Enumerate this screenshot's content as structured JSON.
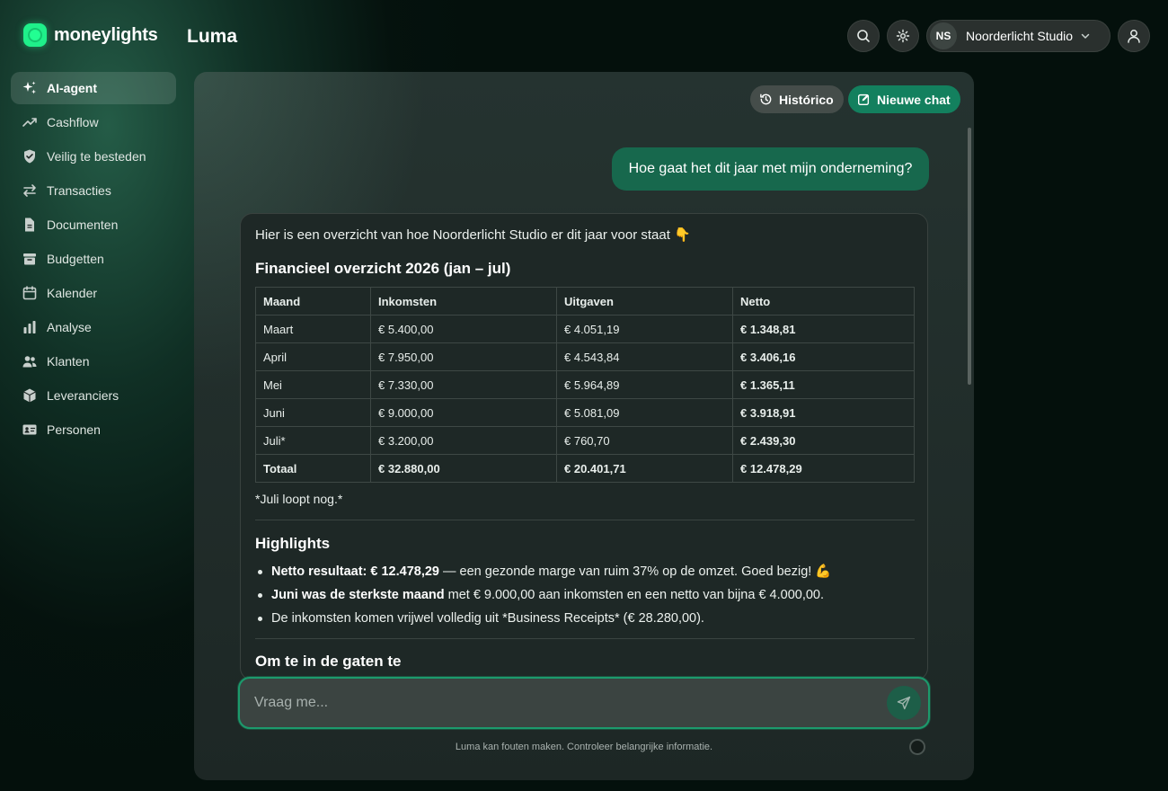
{
  "brand": {
    "logo_text": "moneylights",
    "accent": "#1ff08a"
  },
  "header": {
    "title": "Luma",
    "org": {
      "initials": "NS",
      "name": "Noorderlicht Studio"
    }
  },
  "sidebar": {
    "items": [
      {
        "label": "AI-agent",
        "icon": "sparkles-icon",
        "active": true
      },
      {
        "label": "Cashflow",
        "icon": "trend-up-icon"
      },
      {
        "label": "Veilig te besteden",
        "icon": "shield-check-icon"
      },
      {
        "label": "Transacties",
        "icon": "arrows-swap-icon"
      },
      {
        "label": "Documenten",
        "icon": "document-icon"
      },
      {
        "label": "Budgetten",
        "icon": "archive-box-icon"
      },
      {
        "label": "Kalender",
        "icon": "calendar-icon"
      },
      {
        "label": "Analyse",
        "icon": "bar-chart-icon"
      },
      {
        "label": "Klanten",
        "icon": "users-icon"
      },
      {
        "label": "Leveranciers",
        "icon": "cube-icon"
      },
      {
        "label": "Personen",
        "icon": "id-card-icon"
      }
    ]
  },
  "chat": {
    "history_label": "Histórico",
    "new_chat_label": "Nieuwe chat",
    "user_message": "Hoe gaat het dit jaar met mijn onderneming?",
    "reply": {
      "intro": "Hier is een overzicht van hoe Noorderlicht Studio er dit jaar voor staat 👇",
      "table_title": "Financieel overzicht 2026 (jan – jul)",
      "columns": [
        "Maand",
        "Inkomsten",
        "Uitgaven",
        "Netto"
      ],
      "rows": [
        [
          "Maart",
          "€ 5.400,00",
          "€ 4.051,19",
          "€ 1.348,81"
        ],
        [
          "April",
          "€ 7.950,00",
          "€ 4.543,84",
          "€ 3.406,16"
        ],
        [
          "Mei",
          "€ 7.330,00",
          "€ 5.964,89",
          "€ 1.365,11"
        ],
        [
          "Juni",
          "€ 9.000,00",
          "€ 5.081,09",
          "€ 3.918,91"
        ],
        [
          "Juli*",
          "€ 3.200,00",
          "€ 760,70",
          "€ 2.439,30"
        ]
      ],
      "total": [
        "Totaal",
        "€ 32.880,00",
        "€ 20.401,71",
        "€ 12.478,29"
      ],
      "note": "*Juli loopt nog.*",
      "highlights_title": "Highlights",
      "highlights": [
        {
          "bold": "Netto resultaat: € 12.478,29",
          "rest": " — een gezonde marge van ruim 37% op de omzet. Goed bezig! 💪"
        },
        {
          "bold": "Juni was de sterkste maand",
          "rest": " met € 9.000,00 aan inkomsten en een netto van bijna € 4.000,00."
        },
        {
          "bold": "",
          "rest": "De inkomsten komen vrijwel volledig uit *Business Receipts* (€ 28.280,00)."
        }
      ],
      "next_heading": "Om te in de gaten te"
    },
    "input_placeholder": "Vraag me...",
    "disclaimer": "Luma kan fouten maken. Controleer belangrijke informatie."
  }
}
